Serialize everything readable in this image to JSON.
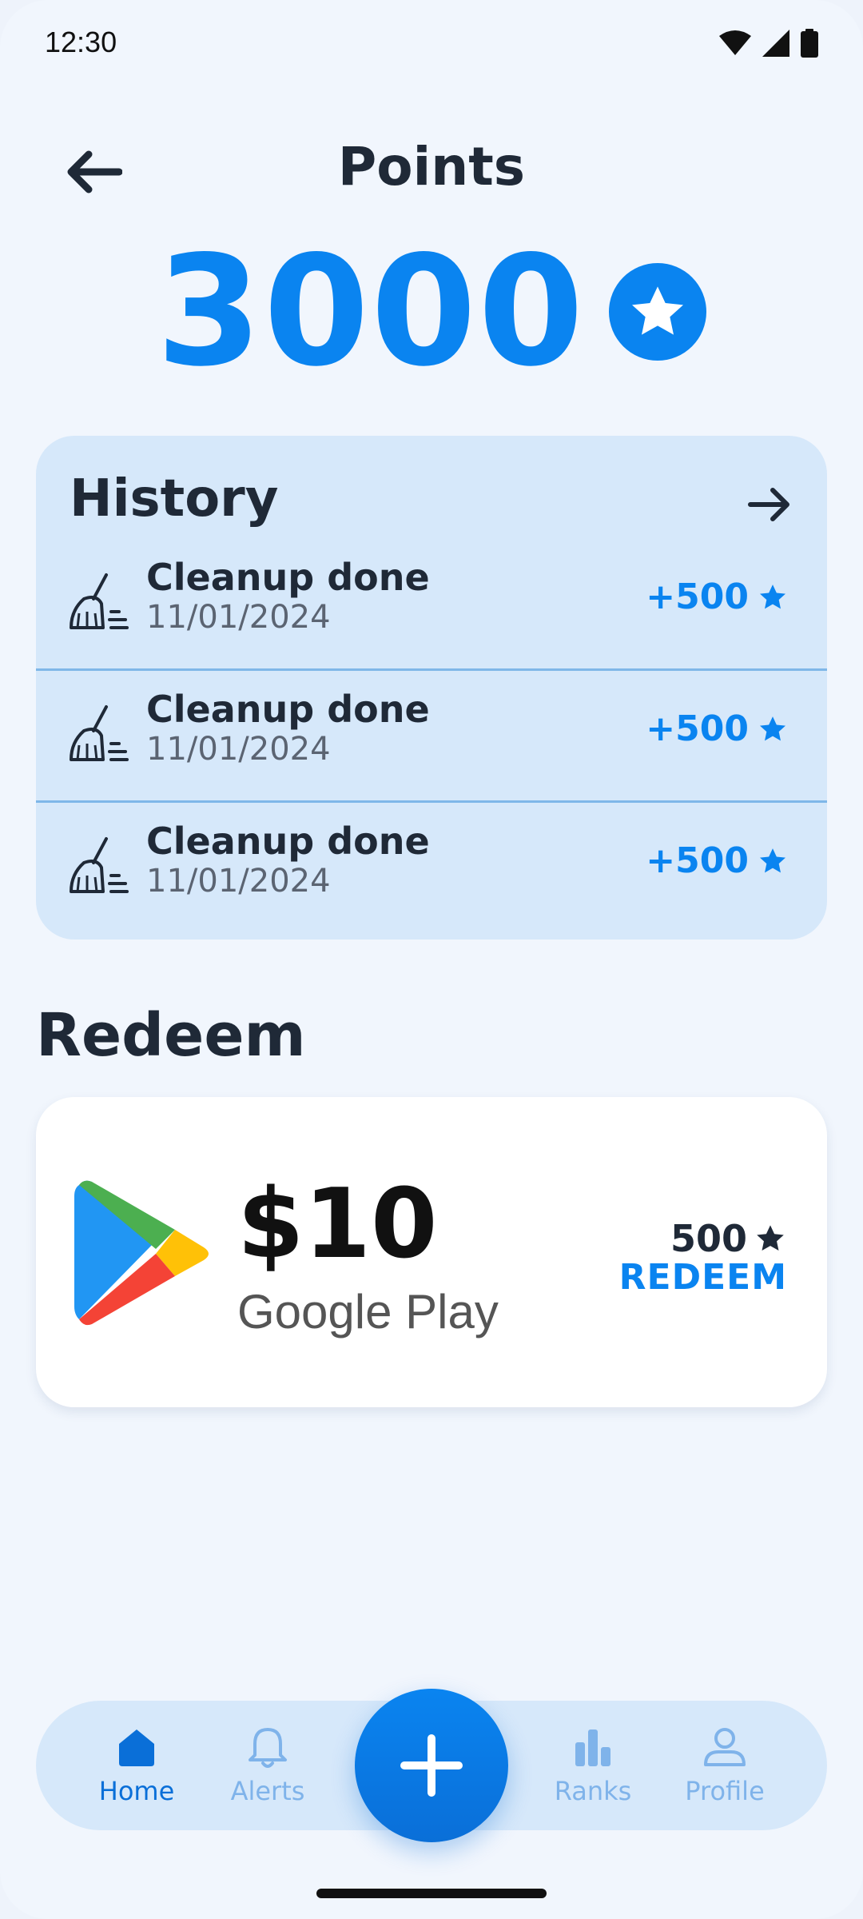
{
  "status_bar": {
    "time": "12:30"
  },
  "header": {
    "title": "Points"
  },
  "points": {
    "total": "3000"
  },
  "history": {
    "title": "History",
    "items": [
      {
        "title": "Cleanup done",
        "date": "11/01/2024",
        "points": "+500"
      },
      {
        "title": "Cleanup done",
        "date": "11/01/2024",
        "points": "+500"
      },
      {
        "title": "Cleanup done",
        "date": "11/01/2024",
        "points": "+500"
      }
    ]
  },
  "redeem": {
    "title": "Redeem",
    "reward": {
      "amount": "$10",
      "brand": "Google Play",
      "cost": "500",
      "action": "REDEEM"
    }
  },
  "bottom_nav": {
    "items": [
      {
        "label": "Home",
        "icon": "home-icon",
        "active": true
      },
      {
        "label": "Alerts",
        "icon": "bell-icon"
      },
      {
        "label": "Ranks",
        "icon": "bar-chart-icon"
      },
      {
        "label": "Profile",
        "icon": "user-icon"
      }
    ],
    "fab_icon": "plus-icon"
  },
  "colors": {
    "accent": "#0a84f0",
    "background": "#f1f6fd",
    "card": "#d6e8fa",
    "text": "#1f2937"
  }
}
